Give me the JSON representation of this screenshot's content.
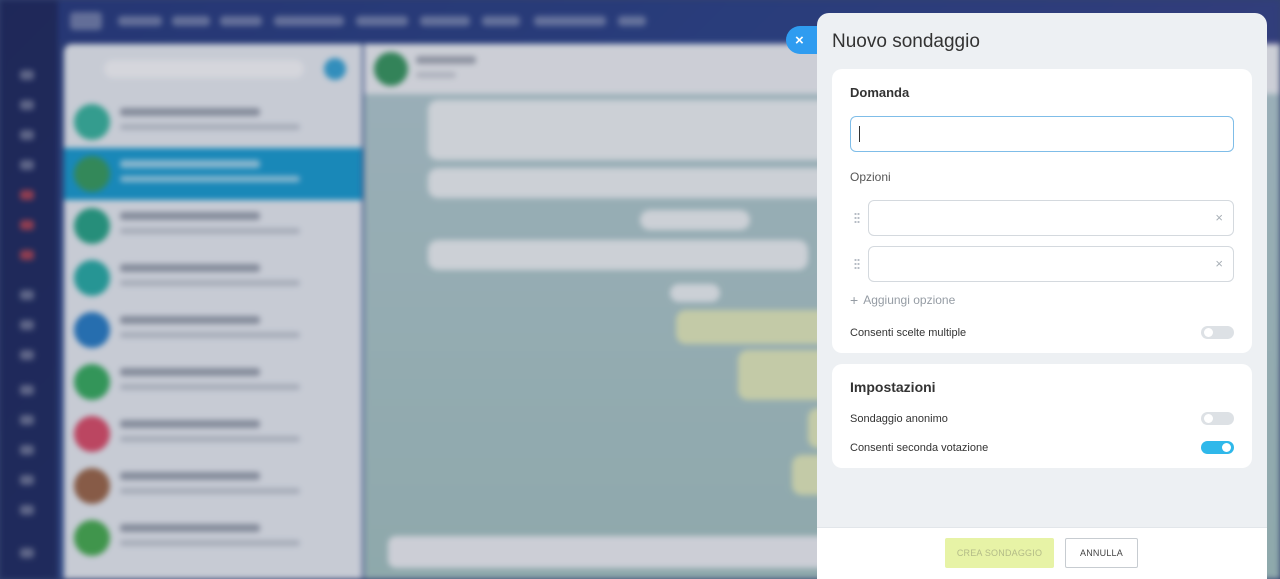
{
  "panel": {
    "title": "Nuovo sondaggio",
    "close_icon": "×"
  },
  "question": {
    "heading": "Domanda",
    "value": "",
    "placeholder": ""
  },
  "options": {
    "heading": "Opzioni",
    "items": [
      {
        "value": "",
        "clear_icon": "×"
      },
      {
        "value": "",
        "clear_icon": "×"
      }
    ],
    "add_icon": "+",
    "add_label": "Aggiungi opzione",
    "multiple_label": "Consenti scelte multiple",
    "multiple_enabled": false
  },
  "settings": {
    "heading": "Impostazioni",
    "anonymous_label": "Sondaggio anonimo",
    "anonymous_enabled": false,
    "revote_label": "Consenti seconda votazione",
    "revote_enabled": true
  },
  "footer": {
    "create_label": "CREA SONDAGGIO",
    "cancel_label": "ANNULLA"
  },
  "colors": {
    "accent": "#2fb8ea",
    "close_button": "#2f9cf0",
    "create_button_bg": "#e7f3a6",
    "panel_bg": "#edf0f3"
  }
}
